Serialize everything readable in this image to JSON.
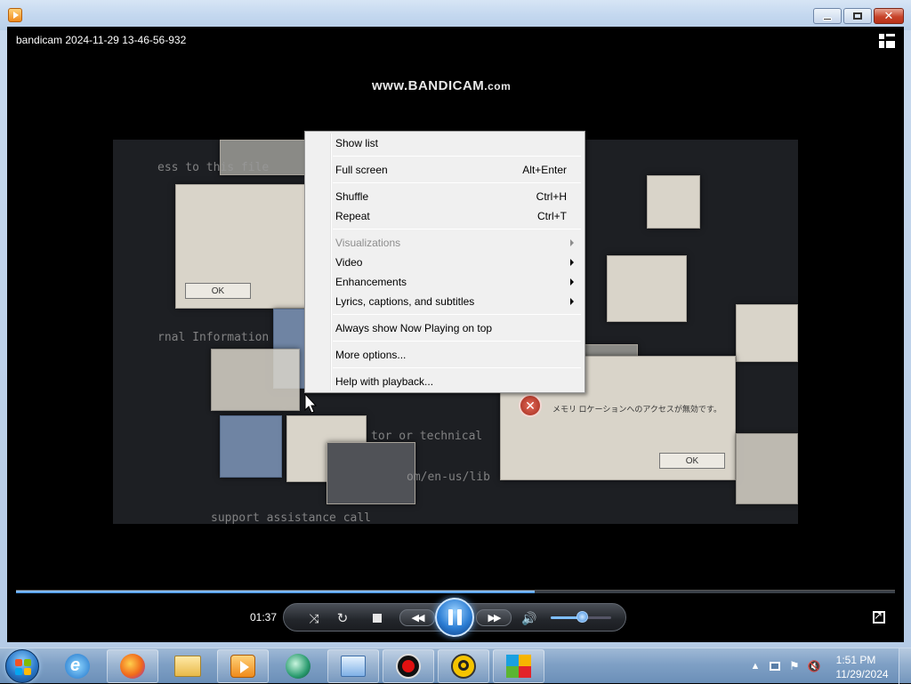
{
  "window": {
    "media_title": "bandicam 2024-11-29 13-46-56-932",
    "watermark_main": "www.BANDICAM",
    "watermark_suffix": ".com"
  },
  "context_menu": {
    "items": [
      {
        "label": "Show list",
        "shortcut": "",
        "submenu": false,
        "disabled": false
      },
      {
        "label": "Full screen",
        "shortcut": "Alt+Enter",
        "submenu": false,
        "disabled": false
      },
      {
        "label": "Shuffle",
        "shortcut": "Ctrl+H",
        "submenu": false,
        "disabled": false
      },
      {
        "label": "Repeat",
        "shortcut": "Ctrl+T",
        "submenu": false,
        "disabled": false
      },
      {
        "label": "Visualizations",
        "shortcut": "",
        "submenu": true,
        "disabled": true
      },
      {
        "label": "Video",
        "shortcut": "",
        "submenu": true,
        "disabled": false
      },
      {
        "label": "Enhancements",
        "shortcut": "",
        "submenu": true,
        "disabled": false
      },
      {
        "label": "Lyrics, captions, and subtitles",
        "shortcut": "",
        "submenu": true,
        "disabled": false
      },
      {
        "label": "Always show Now Playing on top",
        "shortcut": "",
        "submenu": false,
        "disabled": false
      },
      {
        "label": "More options...",
        "shortcut": "",
        "submenu": false,
        "disabled": false
      },
      {
        "label": "Help with playback...",
        "shortcut": "",
        "submenu": false,
        "disabled": false
      }
    ]
  },
  "video": {
    "text_lines": [
      "ess to this file",
      "rnal Information",
      "tor or technical",
      "om/en-us/lib",
      "support assistance call"
    ],
    "dialog_ok": "OK",
    "dialog_ok_2": "OK",
    "error_message": "メモリ ロケーションへのアクセスが無効です。"
  },
  "playback": {
    "elapsed": "01:37",
    "progress_fraction": 0.59,
    "volume_fraction": 0.52
  },
  "taskbar": {
    "time": "1:51 PM",
    "date": "11/29/2024"
  },
  "colors": {
    "accent_blue": "#3b8ee0",
    "menu_bg": "#f0f0f0",
    "close_red": "#c7442a"
  },
  "icons": {
    "switch_view": "switch-to-library-icon",
    "shuffle": "shuffle-icon",
    "repeat": "repeat-icon",
    "stop": "stop-icon",
    "previous": "previous-icon",
    "pause": "pause-icon",
    "next": "next-icon",
    "mute": "speaker-icon",
    "fullscreen": "fullscreen-icon"
  }
}
